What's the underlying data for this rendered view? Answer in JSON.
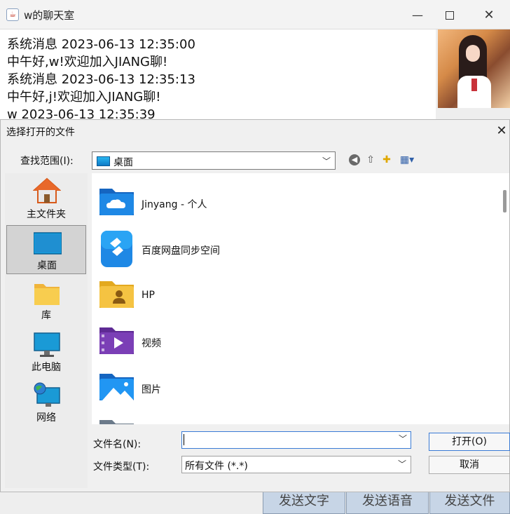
{
  "chat_window": {
    "title": "w的聊天室",
    "app_icon": "java-cup-icon",
    "controls": {
      "minimize": "—",
      "close": "✕"
    },
    "messages": [
      "系统消息 2023-06-13 12:35:00",
      "中午好,w!欢迎加入JIANG聊!",
      "系统消息 2023-06-13 12:35:13",
      "中午好,j!欢迎加入JIANG聊!",
      "w 2023-06-13 12:35:39"
    ],
    "buttons": {
      "send_text": "发送文字",
      "send_voice": "发送语音",
      "send_file": "发送文件"
    }
  },
  "dialog": {
    "title": "选择打开的文件",
    "close": "✕",
    "look_in_label": "查找范围(I):",
    "look_in_value": "桌面",
    "toolbar_icons": [
      "back-icon",
      "up-folder-icon",
      "new-folder-icon",
      "view-menu-icon"
    ],
    "places": [
      {
        "label": "主文件夹",
        "icon": "home-icon",
        "selected": false
      },
      {
        "label": "桌面",
        "icon": "desktop-icon",
        "selected": true
      },
      {
        "label": "库",
        "icon": "library-folder-icon",
        "selected": false
      },
      {
        "label": "此电脑",
        "icon": "computer-icon",
        "selected": false
      },
      {
        "label": "网络",
        "icon": "network-icon",
        "selected": false
      }
    ],
    "files": [
      {
        "name": "Jinyang - 个人",
        "icon": "onedrive-folder-icon"
      },
      {
        "name": "百度网盘同步空间",
        "icon": "baidu-netdisk-icon"
      },
      {
        "name": "HP",
        "icon": "user-folder-icon"
      },
      {
        "name": "视频",
        "icon": "videos-folder-icon"
      },
      {
        "name": "图片",
        "icon": "pictures-folder-icon"
      }
    ],
    "filename_label": "文件名(N):",
    "filename_value": "",
    "filetype_label": "文件类型(T):",
    "filetype_value": "所有文件 (*.*)",
    "open_button": "打开(O)",
    "cancel_button": "取消",
    "colors": {
      "accent": "#3a7bd5",
      "folder_blue": "#1e88e5",
      "folder_yellow": "#f5c342",
      "folder_purple": "#7b3fb6"
    }
  }
}
